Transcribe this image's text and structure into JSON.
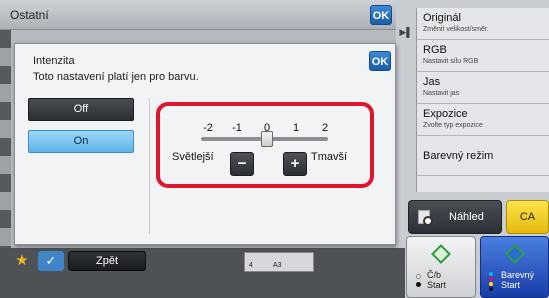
{
  "base": {
    "title": "Ostatní",
    "ok_label": "OK"
  },
  "right_panel": {
    "items": [
      {
        "label": "Originál",
        "sub": "Změnit velikost/směr."
      },
      {
        "label": "RGB",
        "sub": "Nastavit sílu RGB"
      },
      {
        "label": "Jas",
        "sub": "Nastavit jas"
      },
      {
        "label": "Expozice",
        "sub": "Zvolte typ expozice"
      },
      {
        "label": "Barevný režim",
        "sub": ""
      }
    ],
    "preview_label": "Náhled",
    "ca_label": "CA",
    "start_bw": {
      "line1": "Č/b",
      "line2": "Start"
    },
    "start_color": {
      "line1": "Barevný",
      "line2": "Start"
    }
  },
  "bottom_bar": {
    "back_label": "Zpět",
    "paper_count": "4",
    "paper_size": "A3"
  },
  "dialog": {
    "title": "Intenzita",
    "note": "Toto nastavení platí jen pro barvu.",
    "ok_label": "OK",
    "options": {
      "off": "Off",
      "on": "On"
    },
    "selected_option": "On",
    "slider": {
      "ticks": [
        "-2",
        "-1",
        "0",
        "1",
        "2"
      ],
      "value": 0,
      "min_label": "Světlejší",
      "max_label": "Tmavší",
      "minus_label": "−",
      "plus_label": "+"
    },
    "highlight_color": "#e0152f"
  }
}
